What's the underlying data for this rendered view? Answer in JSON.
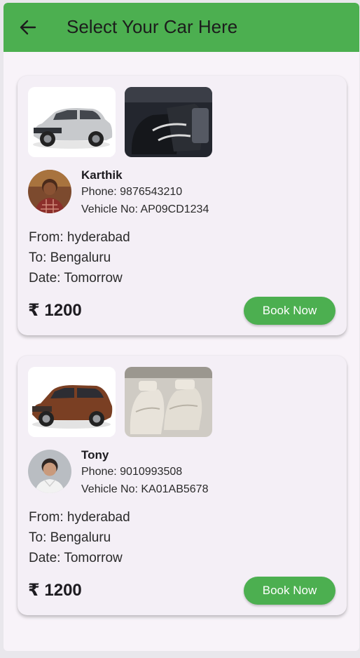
{
  "app_bar": {
    "title": "Select Your Car Here",
    "back_icon": "arrow-left-icon",
    "color": "#4caf50"
  },
  "cars": [
    {
      "driver_name": "Karthik",
      "phone": "Phone: 9876543210",
      "vehicle_no": "Vehicle No: AP09CD1234",
      "from": "From: hyderabad",
      "to": "To: Bengaluru",
      "date": "Date: Tomorrow",
      "price": "₹ 1200",
      "book_label": "Book Now"
    },
    {
      "driver_name": "Tony",
      "phone": "Phone: 9010993508",
      "vehicle_no": "Vehicle No: KA01AB5678",
      "from": "From: hyderabad",
      "to": "To: Bengaluru",
      "date": "Date: Tomorrow",
      "price": "₹ 1200",
      "book_label": "Book Now"
    }
  ]
}
